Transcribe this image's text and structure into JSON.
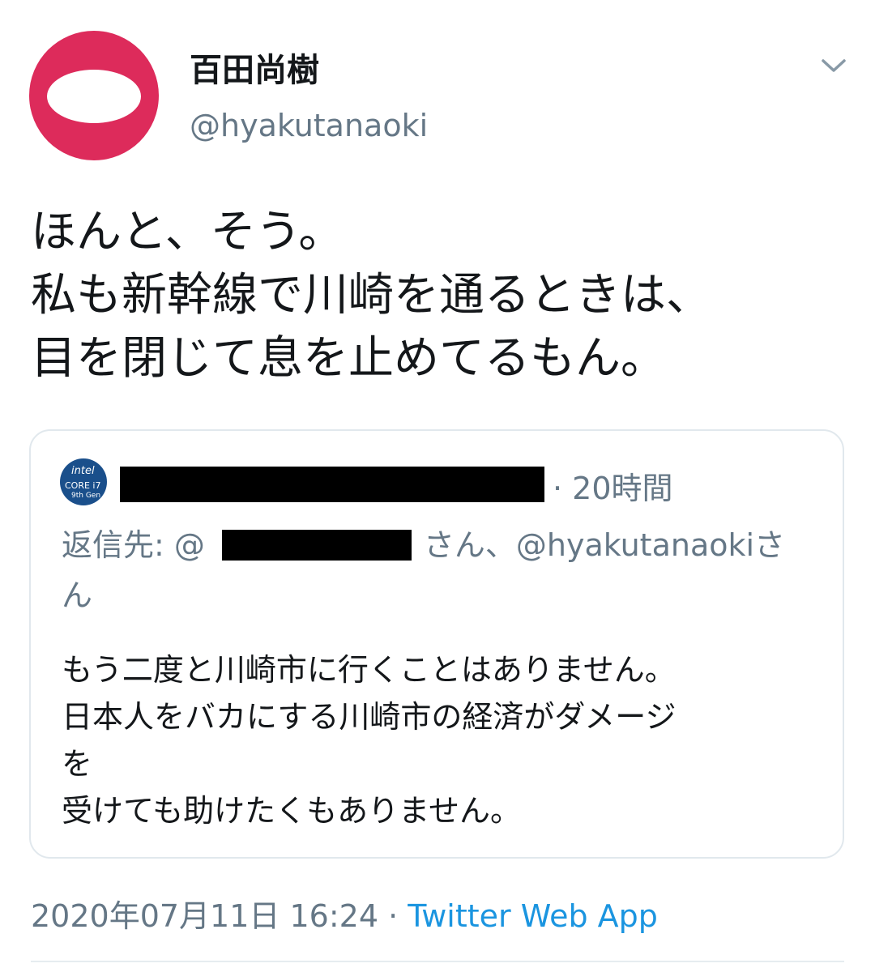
{
  "author": {
    "display_name": "百田尚樹",
    "handle": "@hyakutanaoki",
    "avatar_color": "#dd2b5b"
  },
  "tweet": {
    "text": "ほんと、そう。\n私も新幹線で川崎を通るときは、\n目を閉じて息を止めてるもん。",
    "timestamp": "2020年07月11日 16:24",
    "separator": "·",
    "source": "Twitter Web App"
  },
  "quoted": {
    "avatar_text": {
      "brand": "intel",
      "line1": "CORE i7",
      "line2": "9th Gen"
    },
    "time_ago": "20時間",
    "reply_prefix": "返信先: @",
    "reply_suffix": "さん、@hyakutanaokiさん",
    "text": "もう二度と川崎市に行くことはありません。\n日本人をバカにする川崎市の経済がダメージ\nを\n受けても助けたくもありません。"
  },
  "icons": {
    "menu": "chevron-down-icon"
  },
  "colors": {
    "link": "#1b95e0",
    "muted": "#657786",
    "border": "#e1e8ed"
  }
}
